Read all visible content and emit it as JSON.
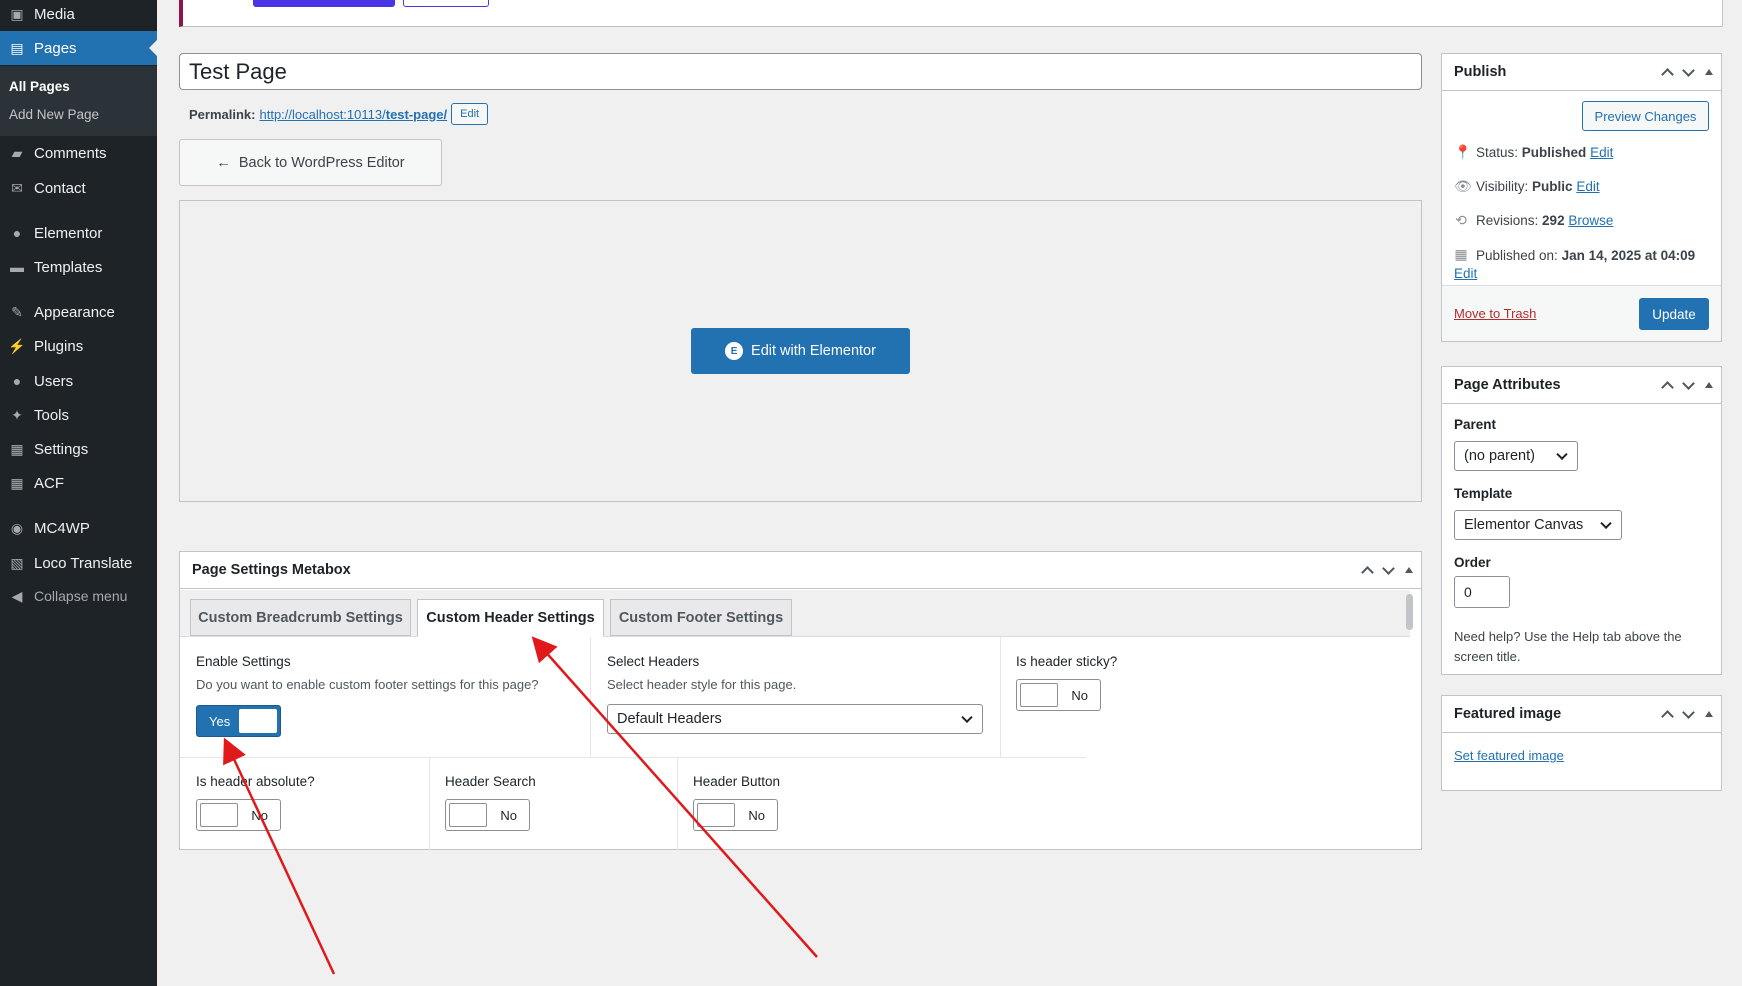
{
  "sidebar": {
    "items": [
      {
        "label": "Media",
        "icon": "media-icon"
      },
      {
        "label": "Pages",
        "icon": "pages-icon"
      },
      {
        "label": "Comments",
        "icon": "comments-icon"
      },
      {
        "label": "Contact",
        "icon": "mail-icon"
      },
      {
        "label": "Elementor",
        "icon": "elementor-icon"
      },
      {
        "label": "Templates",
        "icon": "folder-icon"
      },
      {
        "label": "Appearance",
        "icon": "brush-icon"
      },
      {
        "label": "Plugins",
        "icon": "plug-icon"
      },
      {
        "label": "Users",
        "icon": "user-icon"
      },
      {
        "label": "Tools",
        "icon": "wrench-icon"
      },
      {
        "label": "Settings",
        "icon": "settings-icon"
      },
      {
        "label": "ACF",
        "icon": "grid-icon"
      },
      {
        "label": "MC4WP",
        "icon": "mc4wp-icon"
      },
      {
        "label": "Loco Translate",
        "icon": "translate-icon"
      },
      {
        "label": "Collapse menu",
        "icon": "collapse-icon"
      }
    ],
    "submenu": [
      "All Pages",
      "Add New Page"
    ]
  },
  "editor": {
    "title": "Test Page",
    "permalink_label": "Permalink:",
    "permalink_base": "http://localhost:10113/",
    "permalink_slug": "test-page/",
    "permalink_edit": "Edit",
    "back_button": "Back to WordPress Editor",
    "edit_elementor": "Edit with Elementor"
  },
  "metabox": {
    "title": "Page Settings Metabox",
    "tabs": [
      "Custom Breadcrumb Settings",
      "Custom Header Settings",
      "Custom Footer Settings"
    ],
    "active_tab": "Custom Header Settings",
    "fields": {
      "enable": {
        "label": "Enable Settings",
        "desc": "Do you want to enable custom footer settings for this page?",
        "value": "Yes"
      },
      "select_headers": {
        "label": "Select Headers",
        "desc": "Select header style for this page.",
        "value": "Default Headers"
      },
      "sticky": {
        "label": "Is header sticky?",
        "value": "No"
      },
      "absolute": {
        "label": "Is header absolute?",
        "value": "No"
      },
      "search": {
        "label": "Header Search",
        "value": "No"
      },
      "button": {
        "label": "Header Button",
        "value": "No"
      }
    }
  },
  "publish": {
    "title": "Publish",
    "preview": "Preview Changes",
    "status_label": "Status:",
    "status_value": "Published",
    "status_edit": "Edit",
    "visibility_label": "Visibility:",
    "visibility_value": "Public",
    "visibility_edit": "Edit",
    "revisions_label": "Revisions:",
    "revisions_value": "292",
    "revisions_link": "Browse",
    "published_label": "Published on:",
    "published_value": "Jan 14, 2025 at 04:09",
    "published_edit": "Edit",
    "trash": "Move to Trash",
    "update": "Update"
  },
  "page_attributes": {
    "title": "Page Attributes",
    "parent_label": "Parent",
    "parent_value": "(no parent)",
    "template_label": "Template",
    "template_value": "Elementor Canvas",
    "order_label": "Order",
    "order_value": "0",
    "help": "Need help? Use the Help tab above the screen title."
  },
  "featured": {
    "title": "Featured image",
    "link": "Set featured image"
  },
  "colors": {
    "accent": "#2271b1",
    "sidebar": "#1d2327",
    "annotation": "#e0191b"
  }
}
